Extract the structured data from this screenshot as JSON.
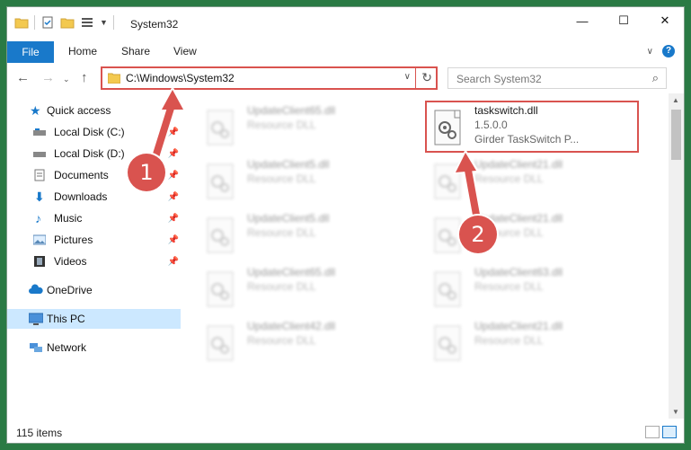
{
  "window": {
    "title": "System32",
    "controls": {
      "minimize": "—",
      "maximize": "☐",
      "close": "✕"
    }
  },
  "ribbon": {
    "tabs": [
      {
        "label": "File"
      },
      {
        "label": "Home"
      },
      {
        "label": "Share"
      },
      {
        "label": "View"
      }
    ]
  },
  "address": {
    "path": "C:\\Windows\\System32",
    "search_placeholder": "Search System32"
  },
  "sidebar": {
    "items": [
      {
        "label": "Quick access"
      },
      {
        "label": "Local Disk (C:)"
      },
      {
        "label": "Local Disk (D:)"
      },
      {
        "label": "Documents"
      },
      {
        "label": "Downloads"
      },
      {
        "label": "Music"
      },
      {
        "label": "Pictures"
      },
      {
        "label": "Videos"
      },
      {
        "label": "OneDrive"
      },
      {
        "label": "This PC"
      },
      {
        "label": "Network"
      }
    ]
  },
  "files": {
    "left": [
      {
        "name": "UpdateClient65.dll",
        "desc": "Resource DLL"
      },
      {
        "name": "UpdateClient5.dll",
        "desc": "Resource DLL"
      },
      {
        "name": "UpdateClient5.dll",
        "desc": "Resource DLL"
      },
      {
        "name": "UpdateClient65.dll",
        "desc": "Resource DLL"
      },
      {
        "name": "UpdateClient42.dll",
        "desc": "Resource DLL"
      }
    ],
    "right": [
      {
        "name": "taskswitch.dll",
        "version": "1.5.0.0",
        "desc": "Girder TaskSwitch P..."
      },
      {
        "name": "UpdateClient21.dll",
        "desc": "Resource DLL"
      },
      {
        "name": "UpdateClient21.dll",
        "desc": "Resource DLL"
      },
      {
        "name": "UpdateClient63.dll",
        "desc": "Resource DLL"
      },
      {
        "name": "UpdateClient21.dll",
        "desc": "Resource DLL"
      }
    ]
  },
  "status": {
    "item_count": "115 items"
  },
  "annotations": {
    "step1": "1",
    "step2": "2",
    "accent": "#d9534f"
  }
}
